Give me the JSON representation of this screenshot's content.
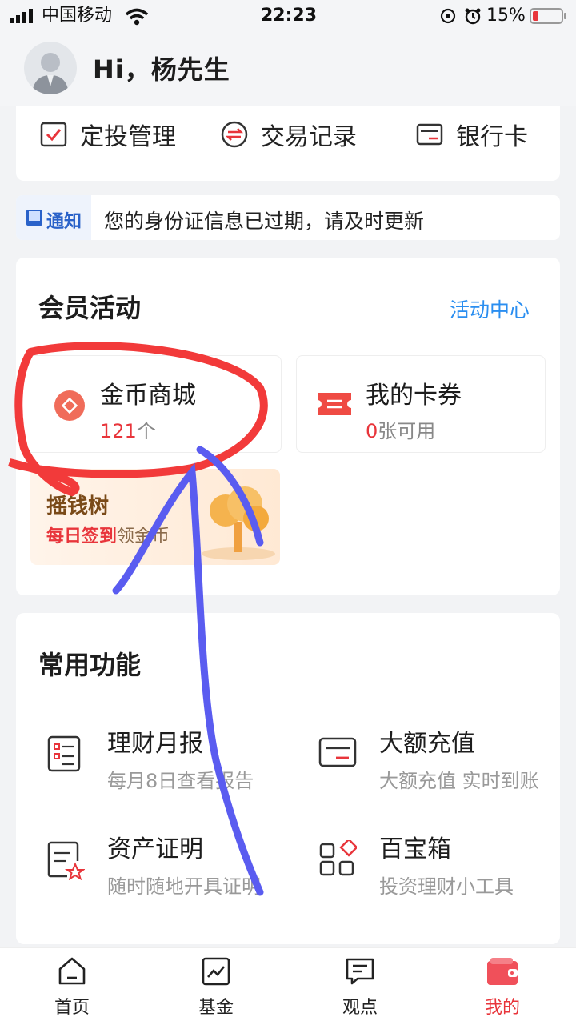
{
  "status_bar": {
    "carrier": "中国移动",
    "time": "22:23",
    "battery": "15%"
  },
  "header": {
    "greeting": "Hi，杨先生"
  },
  "quick_actions": [
    {
      "label": "定投管理",
      "icon": "checkbox-icon"
    },
    {
      "label": "交易记录",
      "icon": "swap-icon"
    },
    {
      "label": "银行卡",
      "icon": "bank-card-icon"
    }
  ],
  "notice": {
    "tag": "通知",
    "text": "您的身份证信息已过期，请及时更新"
  },
  "member": {
    "title": "会员活动",
    "link": "活动中心",
    "coin_mall": {
      "title": "金币商城",
      "count_num": "121",
      "count_unit": "个"
    },
    "coupons": {
      "title": "我的卡券",
      "count_num": "0",
      "count_unit": "张可用"
    },
    "money_tree": {
      "title": "摇钱树",
      "sub_red": "每日签到",
      "sub_rest": "领金币"
    }
  },
  "common": {
    "title": "常用功能",
    "items": [
      {
        "title": "理财月报",
        "sub": "每月8日查看报告",
        "icon": "report-icon"
      },
      {
        "title": "大额充值",
        "sub": "大额充值 实时到账",
        "icon": "recharge-card-icon"
      },
      {
        "title": "资产证明",
        "sub": "随时随地开具证明",
        "icon": "certificate-icon"
      },
      {
        "title": "百宝箱",
        "sub": "投资理财小工具",
        "icon": "toolbox-icon"
      }
    ]
  },
  "tabbar": [
    {
      "label": "首页",
      "icon": "home-icon",
      "active": false
    },
    {
      "label": "基金",
      "icon": "fund-chart-icon",
      "active": false
    },
    {
      "label": "观点",
      "icon": "message-icon",
      "active": false
    },
    {
      "label": "我的",
      "icon": "wallet-icon",
      "active": true
    }
  ],
  "colors": {
    "accent_red": "#e8353b",
    "link_blue": "#2a8ef0",
    "annotation_red": "#f23a3a",
    "annotation_blue": "#5a5cf0"
  }
}
